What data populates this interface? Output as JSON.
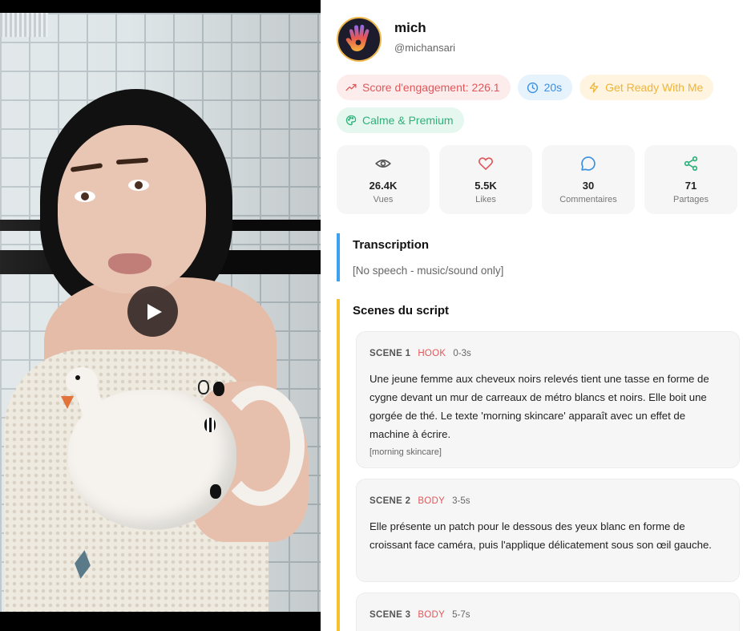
{
  "video": {
    "play_icon": "play-icon"
  },
  "profile": {
    "name": "mich",
    "handle": "@michansari",
    "avatar_icon": "hand-logo-icon"
  },
  "badges": {
    "engagement": "Score d'engagement: 226.1",
    "duration": "20s",
    "category": "Get Ready With Me",
    "mood": "Calme & Premium"
  },
  "stats": [
    {
      "icon": "eye-icon",
      "value": "26.4K",
      "label": "Vues",
      "color": "#555555"
    },
    {
      "icon": "heart-icon",
      "value": "5.5K",
      "label": "Likes",
      "color": "#e0575a"
    },
    {
      "icon": "comment-icon",
      "value": "30",
      "label": "Commentaires",
      "color": "#3a8fe0"
    },
    {
      "icon": "share-icon",
      "value": "71",
      "label": "Partages",
      "color": "#2fb07a"
    }
  ],
  "transcription": {
    "title": "Transcription",
    "text": "[No speech - music/sound only]"
  },
  "scenes": {
    "title": "Scenes du script",
    "items": [
      {
        "number": "SCENE 1",
        "type": "HOOK",
        "time": "0-3s",
        "description": "Une jeune femme aux cheveux noirs relevés tient une tasse en forme de cygne devant un mur de carreaux de métro blancs et noirs. Elle boit une gorgée de thé. Le texte 'morning skincare' apparaît avec un effet de machine à écrire.",
        "overlay": "[morning skincare]"
      },
      {
        "number": "SCENE 2",
        "type": "BODY",
        "time": "3-5s",
        "description": "Elle présente un patch pour le dessous des yeux blanc en forme de croissant face caméra, puis l'applique délicatement sous son œil gauche.",
        "overlay": ""
      },
      {
        "number": "SCENE 3",
        "type": "BODY",
        "time": "5-7s",
        "description": "",
        "overlay": ""
      }
    ]
  },
  "colors": {
    "accent_red": "#e0575a",
    "accent_blue": "#3ba1f0",
    "accent_yellow": "#f5c12e",
    "accent_green": "#2fb07a"
  }
}
